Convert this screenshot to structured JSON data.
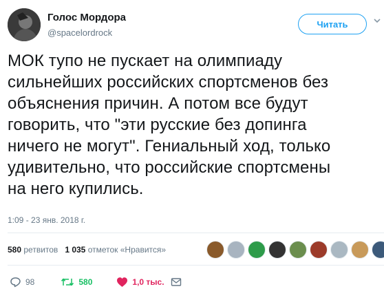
{
  "author": {
    "name": "Голос Мордора",
    "handle": "@spacelordrock"
  },
  "follow_button_label": "Читать",
  "tweet": {
    "text": "МОК тупо не пускает на олимпиаду\nсильнейших российских спортсменов без\nобъяснения причин. А потом все будут\nговорить, что \"эти русские без допинга\nничего не могут\". Гениальный ход, только\nудивительно, что российские спортсмены\nна него купились.",
    "timestamp": "1:09 - 23 янв. 2018 г."
  },
  "stats": {
    "retweets_count": "580",
    "retweets_label": "ретвитов",
    "likes_count": "1 035",
    "likes_label": "отметок «Нравится»"
  },
  "liker_avatars": [
    {
      "color": "#8a5a2b"
    },
    {
      "color": "#a8b4c0"
    },
    {
      "color": "#2e9b4a"
    },
    {
      "color": "#333333"
    },
    {
      "color": "#6b8e4e"
    },
    {
      "color": "#9c3b2a"
    },
    {
      "color": "#aab8c2"
    },
    {
      "color": "#c89a5a"
    },
    {
      "color": "#3c5a7a"
    }
  ],
  "actions": {
    "reply_count": "98",
    "retweet_count": "580",
    "like_count": "1,0 тыс."
  },
  "colors": {
    "accent": "#1da1f2",
    "retweet": "#17bf63",
    "like": "#e0245e",
    "muted": "#657786"
  },
  "icons": {
    "reply": "speech-bubble-icon",
    "retweet": "retweet-arrows-icon",
    "like": "heart-icon",
    "message": "envelope-icon",
    "caret": "chevron-down-icon"
  }
}
